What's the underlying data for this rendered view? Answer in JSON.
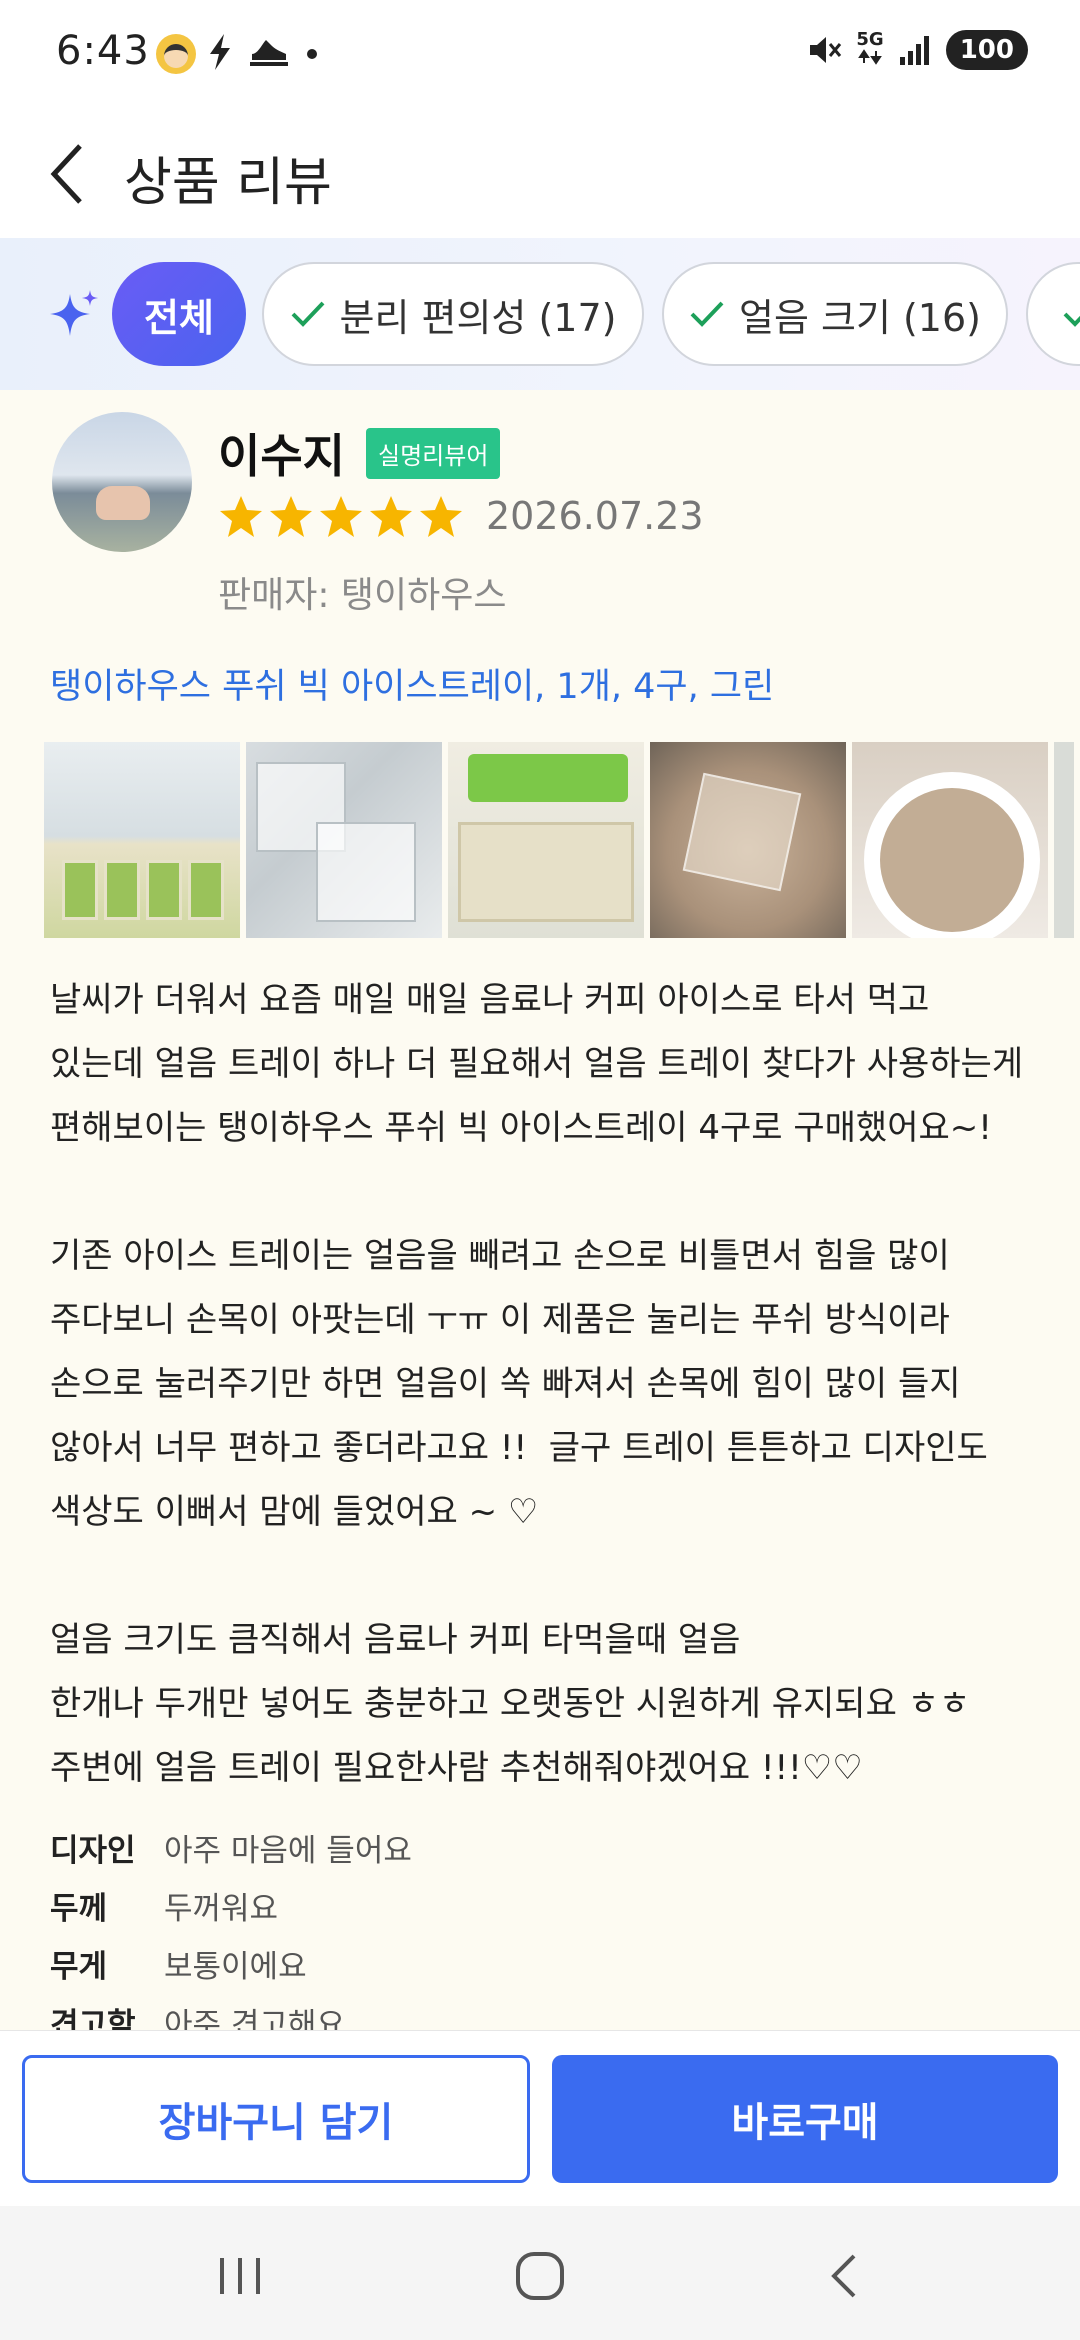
{
  "status_bar": {
    "time": "6:43",
    "network": "5G",
    "battery": "100"
  },
  "header": {
    "title": "상품 리뷰"
  },
  "filters": {
    "all_label": "전체",
    "chips": [
      {
        "label": "분리 편의성 (17)"
      },
      {
        "label": "얼음 크기 (16)"
      }
    ]
  },
  "review": {
    "reviewer_name": "이수지",
    "badge": "실명리뷰어",
    "rating": 5,
    "date": "2026.07.23",
    "seller": "판매자: 탱이하우스",
    "product_option": "탱이하우스 푸쉬 빅 아이스트레이, 1개, 4구, 그린",
    "text": "날씨가 더워서 요즘 매일 매일 음료나 커피 아이스로 타서 먹고\n있는데 얼음 트레이 하나 더 필요해서 얼음 트레이 찾다가 사용하는게\n편해보이는 탱이하우스 푸쉬 빅 아이스트레이 4구로 구매했어요~!\n\n기존 아이스 트레이는 얼음을 빼려고 손으로 비틀면서 힘을 많이\n주다보니 손목이 아팟는데 ㅜㅠ 이 제품은 눌리는 푸쉬 방식이라\n손으로 눌러주기만 하면 얼음이 쏙 빠져서 손목에 힘이 많이 들지\n않아서 너무 편하고 좋더라고요 !!  글구 트레이 튼튼하고 디자인도\n색상도 이뻐서 맘에 들었어요 ~ ♡\n\n얼음 크기도 큼직해서 음료나 커피 타먹을때 얼음\n한개나 두개만 넣어도 충분하고 오랫동안 시원하게 유지되요 ㅎㅎ\n주변에 얼음 트레이 필요한사람 추천해줘야겠어요 !!!♡♡",
    "attributes": [
      {
        "key": "디자인",
        "value": "아주 마음에 들어요"
      },
      {
        "key": "두께",
        "value": "두꺼워요"
      },
      {
        "key": "무게",
        "value": "보통이에요"
      },
      {
        "key": "견고함",
        "value": "아주 견고해요"
      }
    ]
  },
  "actions": {
    "cart_label": "장바구니 담기",
    "buy_label": "바로구매"
  },
  "colors": {
    "accent": "#3a6bf0",
    "star": "#f7b500",
    "badge": "#29c48a",
    "option_link": "#2e6fe0"
  }
}
